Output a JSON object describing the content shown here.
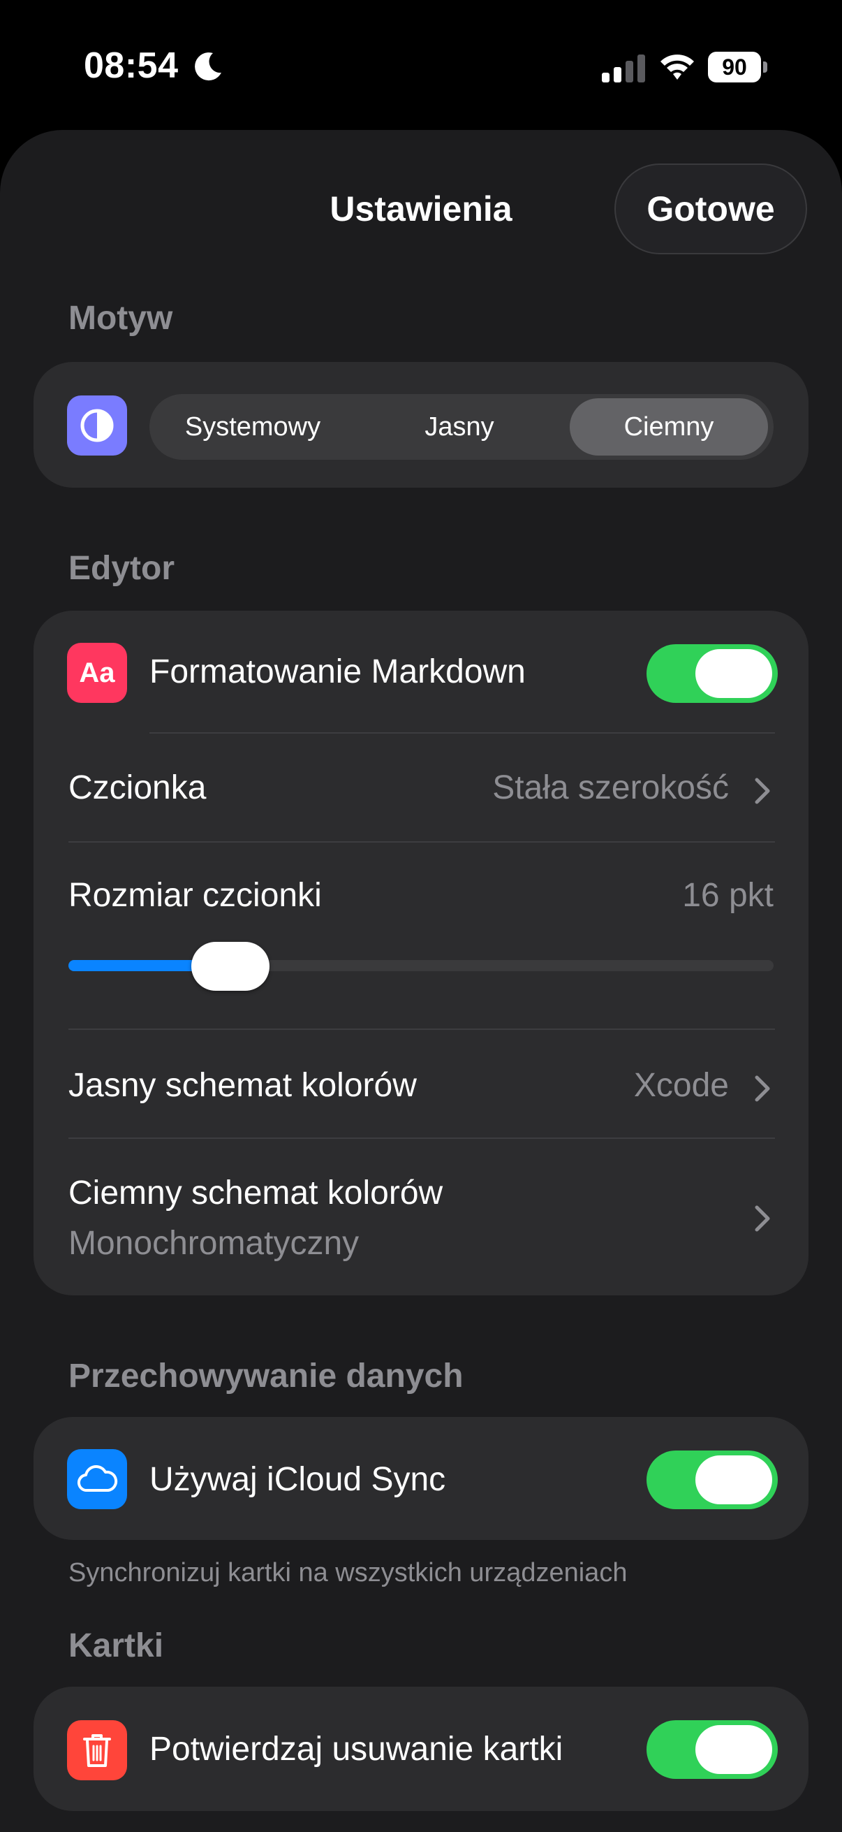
{
  "status_bar": {
    "time": "08:54",
    "battery_level": "90"
  },
  "nav": {
    "title": "Ustawienia",
    "done_label": "Gotowe"
  },
  "theme": {
    "header": "Motyw",
    "options": [
      "Systemowy",
      "Jasny",
      "Ciemny"
    ],
    "selected": "Ciemny",
    "icon": "theme-contrast-icon"
  },
  "editor": {
    "header": "Edytor",
    "markdown": {
      "label": "Formatowanie Markdown",
      "enabled": true,
      "icon": "text-format-icon",
      "icon_text": "Aa"
    },
    "font": {
      "label": "Czcionka",
      "value": "Stała szerokość"
    },
    "font_size": {
      "label": "Rozmiar czcionki",
      "value": "16 pkt",
      "slider_fraction": 0.23
    },
    "light_scheme": {
      "label": "Jasny schemat kolorów",
      "value": "Xcode"
    },
    "dark_scheme": {
      "label": "Ciemny schemat kolorów",
      "value": "Monochromatyczny"
    }
  },
  "storage": {
    "header": "Przechowywanie danych",
    "icloud": {
      "label": "Używaj iCloud Sync",
      "enabled": true,
      "icon": "cloud-icon"
    },
    "footnote": "Synchronizuj kartki na wszystkich urządzeniach"
  },
  "cards": {
    "header": "Kartki",
    "confirm_delete": {
      "label": "Potwierdzaj usuwanie kartki",
      "enabled": true,
      "icon": "trash-icon"
    }
  },
  "colors": {
    "accent_blue": "#0a84ff",
    "toggle_on": "#30d158",
    "theme_icon_bg": "#7a7cff",
    "markdown_icon_bg": "#ff375f",
    "icloud_icon_bg": "#0a84ff",
    "trash_icon_bg": "#ff453a"
  }
}
